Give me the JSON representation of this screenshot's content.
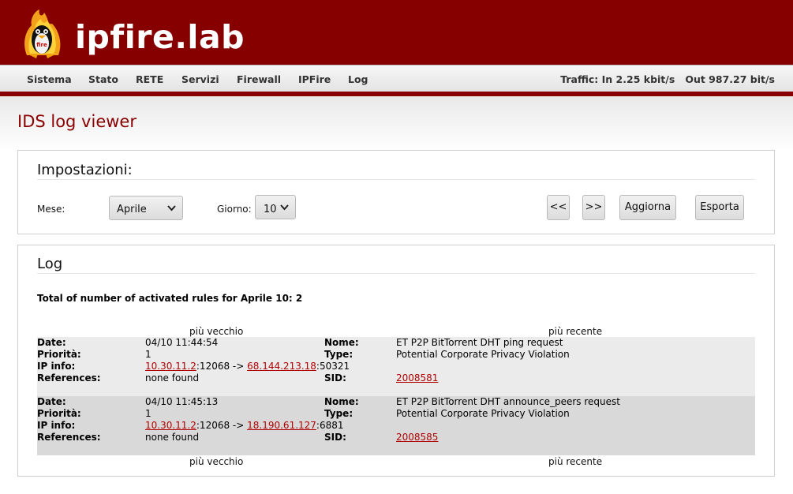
{
  "header": {
    "title": "ipfire.lab"
  },
  "nav": {
    "items": [
      "Sistema",
      "Stato",
      "RETE",
      "Servizi",
      "Firewall",
      "IPFire",
      "Log"
    ],
    "traffic": "Traffic: In 2.25 kbit/s   Out 987.27 bit/s"
  },
  "page": {
    "title": "IDS log viewer"
  },
  "settings": {
    "title": "Impostazioni:",
    "month_label": "Mese:",
    "month_value": "Aprile",
    "day_label": "Giorno:",
    "day_value": "10",
    "prev_label": "<<",
    "next_label": ">>",
    "refresh_label": "Aggiorna",
    "export_label": "Esporta"
  },
  "log": {
    "title": "Log",
    "summary": "Total of number of activated rules for Aprile 10: 2",
    "older": "più vecchio",
    "newer": "più recente",
    "labels": {
      "date": "Date:",
      "priority": "Priorità:",
      "ip": "IP info:",
      "refs": "References:",
      "name": "Nome:",
      "type": "Type:",
      "sid": "SID:"
    },
    "entries": [
      {
        "date": "04/10 11:44:54",
        "priority": "1",
        "src_ip": "10.30.11.2",
        "src_port": ":12068 -> ",
        "dst_ip": "68.144.213.18",
        "dst_port": ":50321",
        "refs": "none found",
        "name": "ET P2P BitTorrent DHT ping request",
        "type": "Potential Corporate Privacy Violation",
        "sid": "2008581"
      },
      {
        "date": "04/10 11:45:13",
        "priority": "1",
        "src_ip": "10.30.11.2",
        "src_port": ":12068 -> ",
        "dst_ip": "18.190.61.127",
        "dst_port": ":6881",
        "refs": "none found",
        "name": "ET P2P BitTorrent DHT announce_peers request",
        "type": "Potential Corporate Privacy Violation",
        "sid": "2008585"
      }
    ]
  },
  "colors": {
    "brand": "#860000",
    "link": "#b00000",
    "row_alt": "#d9d9d9"
  }
}
